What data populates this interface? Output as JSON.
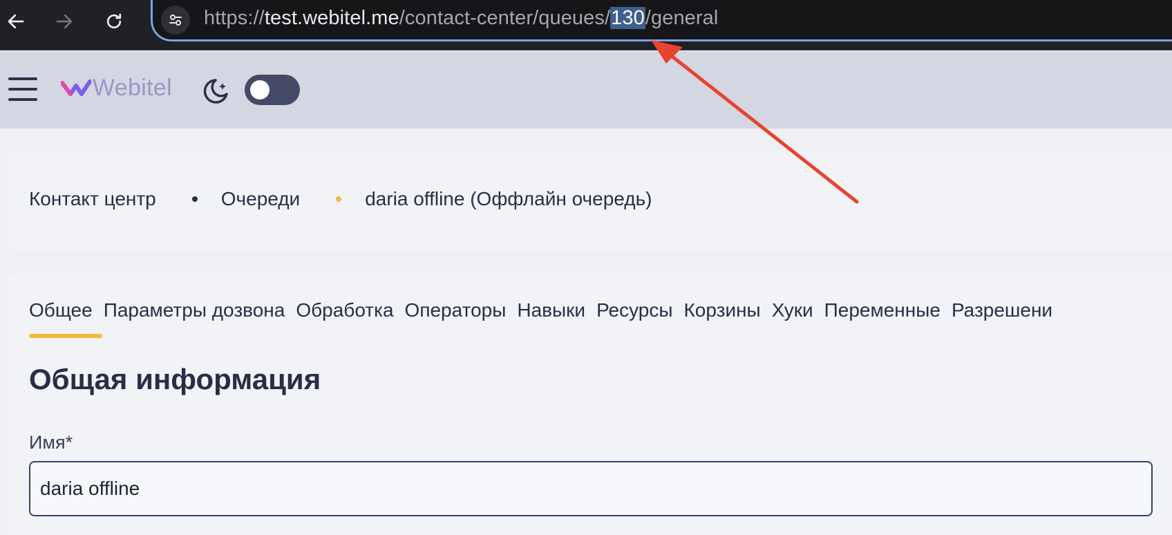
{
  "browser": {
    "url_scheme": "https://",
    "url_host": "test.webitel.me",
    "url_path_pre": "/contact-center/queues/",
    "url_selected": "130",
    "url_path_post": "/general"
  },
  "header": {
    "logo_text": "Webitel",
    "theme_toggle_state": "off"
  },
  "breadcrumb": {
    "items": [
      "Контакт центр",
      "Очереди",
      "daria offline (Оффлайн очередь)"
    ]
  },
  "tabs": {
    "items": [
      "Общее",
      "Параметры дозвона",
      "Обработка",
      "Операторы",
      "Навыки",
      "Ресурсы",
      "Корзины",
      "Хуки",
      "Переменные",
      "Разрешени"
    ],
    "active_index": 0
  },
  "form": {
    "section_title": "Общая информация",
    "name_label": "Имя*",
    "name_value": "daria offline"
  },
  "colors": {
    "accent": "#f4b740",
    "annotation_arrow": "#e8432f",
    "url_highlight": "#3f5f8d"
  }
}
